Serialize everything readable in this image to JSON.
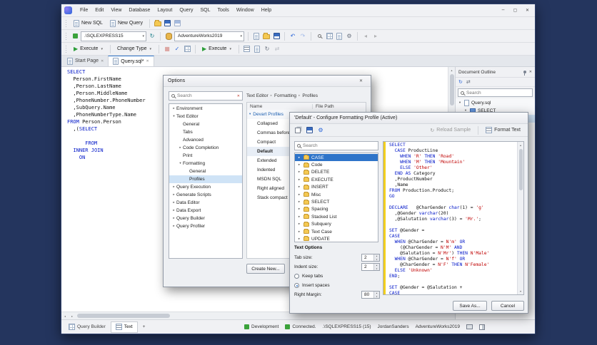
{
  "colors": {
    "accent": "#2e74c9",
    "keyword": "#0016c8",
    "string": "#bf0000",
    "selection": "#2e74c9",
    "change_bar": "#f2cf1e",
    "status_green": "#3ba23b",
    "desktop": "#24355e"
  },
  "icons": {
    "play": "▶",
    "dropdown": "▾",
    "close": "✕",
    "minimize": "─",
    "maximize": "▢",
    "undo": "↶",
    "redo": "↷",
    "refresh": "↻",
    "gear": "⚙",
    "collapsed": "▸",
    "expanded": "▾",
    "chevron": "▸",
    "up": "▴",
    "down": "▾",
    "left": "◂",
    "right": "▸",
    "stop": "■",
    "check": "✓",
    "swap": "⇄"
  },
  "titlebar": {
    "menu": [
      "File",
      "Edit",
      "View",
      "Database",
      "Layout",
      "Query",
      "SQL",
      "Tools",
      "Window",
      "Help"
    ]
  },
  "toolbar_standard": {
    "new_sql": "New SQL",
    "new_query": "New Query"
  },
  "toolbar_connection": {
    "server": ".\\SQLEXPRESS15",
    "database": "AdventureWorks2019"
  },
  "toolbar_query": {
    "execute": "Execute",
    "change_type": "Change Type",
    "execute_secondary": "Execute"
  },
  "doc_tabs": [
    {
      "label": "Start Page"
    },
    {
      "label": "Query.sql*",
      "active": true
    }
  ],
  "editor_code": [
    [
      [
        "k",
        "SELECT"
      ]
    ],
    [
      [
        "p",
        "  Person.FirstName"
      ]
    ],
    [
      [
        "p",
        "  ,Person.LastName"
      ]
    ],
    [
      [
        "p",
        "  ,Person.MiddleName"
      ]
    ],
    [
      [
        "p",
        "  ,PhoneNumber.PhoneNumber"
      ]
    ],
    [
      [
        "p",
        "  ,SubQuery.Name"
      ]
    ],
    [
      [
        "p",
        "  ,PhoneNumberType.Name"
      ]
    ],
    [
      [
        "k",
        "FROM"
      ],
      [
        "p",
        " Person.Person"
      ]
    ],
    [
      [
        "p",
        "  ,("
      ],
      [
        "k",
        "SELECT"
      ]
    ],
    [],
    [
      [
        "p",
        "      "
      ],
      [
        "k",
        "FROM"
      ]
    ],
    [
      [
        "p",
        "  "
      ],
      [
        "k",
        "INNER JOIN"
      ]
    ],
    [
      [
        "p",
        "    "
      ],
      [
        "k",
        "ON"
      ]
    ]
  ],
  "document_outline": {
    "title": "Document Outline",
    "search_placeholder": "Search",
    "tree": [
      {
        "label": "Query.sql",
        "indent": 0,
        "arrow": "expanded",
        "icon": "doc"
      },
      {
        "label": "SELECT",
        "indent": 1,
        "arrow": "expanded",
        "icon": "table"
      },
      {
        "label": "SELECT",
        "indent": 2,
        "icon": "table",
        "selected": true
      }
    ]
  },
  "status_bar": {
    "tabs": [
      {
        "label": "Query Builder",
        "icon": "grid"
      },
      {
        "label": "Text",
        "icon": "text",
        "active": true
      },
      {
        "label": "+",
        "icon": "none"
      }
    ],
    "environment": "Development",
    "connection_state": "Connected.",
    "server": ".\\SQLEXPRESS15 (15)",
    "user": "JordanSanders",
    "database": "AdventureWorks2019"
  },
  "options_dialog": {
    "title": "Options",
    "search_placeholder": "Search",
    "tree": [
      {
        "label": "Environment",
        "indent": 0,
        "arrow": "collapsed"
      },
      {
        "label": "Text Editor",
        "indent": 0,
        "arrow": "expanded"
      },
      {
        "label": "General",
        "indent": 1
      },
      {
        "label": "Tabs",
        "indent": 1
      },
      {
        "label": "Advanced",
        "indent": 1
      },
      {
        "label": "Code Completion",
        "indent": 1,
        "arrow": "collapsed"
      },
      {
        "label": "Print",
        "indent": 1
      },
      {
        "label": "Formatting",
        "indent": 1,
        "arrow": "expanded"
      },
      {
        "label": "General",
        "indent": 2
      },
      {
        "label": "Profiles",
        "indent": 2,
        "selected": true
      },
      {
        "label": "Query Execution",
        "indent": 0,
        "arrow": "collapsed"
      },
      {
        "label": "Generate Scripts",
        "indent": 0,
        "arrow": "collapsed"
      },
      {
        "label": "Data Editor",
        "indent": 0,
        "arrow": "collapsed"
      },
      {
        "label": "Data Export",
        "indent": 0,
        "arrow": "collapsed"
      },
      {
        "label": "Query Builder",
        "indent": 0,
        "arrow": "collapsed"
      },
      {
        "label": "Query Profiler",
        "indent": 0,
        "arrow": "collapsed"
      }
    ],
    "breadcrumb": [
      "Text Editor",
      "Formatting",
      "Profiles"
    ],
    "columns": [
      "Name",
      "File Path"
    ],
    "profiles_group": "Devart Profiles",
    "profiles": [
      {
        "name": "Collapsed"
      },
      {
        "name": "Commas before"
      },
      {
        "name": "Compact"
      },
      {
        "name": "Default",
        "active": true
      },
      {
        "name": "Extended"
      },
      {
        "name": "Indented"
      },
      {
        "name": "MSDN SQL"
      },
      {
        "name": "Right aligned"
      },
      {
        "name": "Stack compact"
      }
    ],
    "create_button": "Create New..."
  },
  "profile_dialog": {
    "title": "'Default' - Configure Formatting Profile (Active)",
    "reload_sample": "Reload Sample",
    "format_text": "Format Text",
    "search_placeholder": "Search",
    "folders": [
      {
        "label": "CASE",
        "selected": true
      },
      {
        "label": "Code"
      },
      {
        "label": "DELETE"
      },
      {
        "label": "EXECUTE"
      },
      {
        "label": "INSERT"
      },
      {
        "label": "Misc"
      },
      {
        "label": "SELECT"
      },
      {
        "label": "Spacing"
      },
      {
        "label": "Stacked List"
      },
      {
        "label": "Subquery"
      },
      {
        "label": "Text Case"
      },
      {
        "label": "UPDATE"
      }
    ],
    "text_options": {
      "heading": "Text Options",
      "tab_size_label": "Tab size:",
      "tab_size": "2",
      "indent_size_label": "Indent size:",
      "indent_size": "2",
      "keep_tabs": "Keep tabs",
      "insert_spaces": "Insert spaces",
      "right_margin_label": "Right Margin:",
      "right_margin": "80"
    },
    "preview_code": [
      [
        [
          "k",
          "SELECT"
        ]
      ],
      [
        [
          "p",
          "  "
        ],
        [
          "k",
          "CASE"
        ],
        [
          "p",
          " ProductLine"
        ]
      ],
      [
        [
          "p",
          "    "
        ],
        [
          "k",
          "WHEN"
        ],
        [
          "p",
          " "
        ],
        [
          "s",
          "'R'"
        ],
        [
          "p",
          " "
        ],
        [
          "k",
          "THEN"
        ],
        [
          "p",
          " "
        ],
        [
          "s",
          "'Road'"
        ]
      ],
      [
        [
          "p",
          "    "
        ],
        [
          "k",
          "WHEN"
        ],
        [
          "p",
          " "
        ],
        [
          "s",
          "'M'"
        ],
        [
          "p",
          " "
        ],
        [
          "k",
          "THEN"
        ],
        [
          "p",
          " "
        ],
        [
          "s",
          "'Mountain'"
        ]
      ],
      [
        [
          "p",
          "    "
        ],
        [
          "k",
          "ELSE"
        ],
        [
          "p",
          " "
        ],
        [
          "s",
          "'Other'"
        ]
      ],
      [
        [
          "p",
          "  "
        ],
        [
          "k",
          "END"
        ],
        [
          "p",
          " "
        ],
        [
          "k",
          "AS"
        ],
        [
          "p",
          " Category"
        ]
      ],
      [
        [
          "p",
          "  ,ProductNumber"
        ]
      ],
      [
        [
          "p",
          "  ,Name"
        ]
      ],
      [
        [
          "k",
          "FROM"
        ],
        [
          "p",
          " Production.Product;"
        ]
      ],
      [
        [
          "k",
          "GO"
        ]
      ],
      [],
      [
        [
          "k",
          "DECLARE"
        ],
        [
          "p",
          "   @CharGender "
        ],
        [
          "k",
          "char"
        ],
        [
          "p",
          "(1) = "
        ],
        [
          "s",
          "'g'"
        ]
      ],
      [
        [
          "p",
          "  ,@Gender "
        ],
        [
          "k",
          "varchar"
        ],
        [
          "p",
          "(20)"
        ]
      ],
      [
        [
          "p",
          "  ,@Salutation "
        ],
        [
          "k",
          "varchar"
        ],
        [
          "p",
          "(3) = "
        ],
        [
          "s",
          "'Mr.'"
        ],
        [
          "p",
          ";"
        ]
      ],
      [],
      [
        [
          "k",
          "SET"
        ],
        [
          "p",
          " @Gender ="
        ]
      ],
      [
        [
          "k",
          "CASE"
        ]
      ],
      [
        [
          "p",
          "  "
        ],
        [
          "k",
          "WHEN"
        ],
        [
          "p",
          " @CharGender = "
        ],
        [
          "s",
          "N'm'"
        ],
        [
          "p",
          " "
        ],
        [
          "k",
          "OR"
        ]
      ],
      [
        [
          "p",
          "    (@CharGender = "
        ],
        [
          "s",
          "N'M'"
        ],
        [
          "p",
          " "
        ],
        [
          "k",
          "AND"
        ]
      ],
      [
        [
          "p",
          "    @Salutation = "
        ],
        [
          "s",
          "N'Mr'"
        ],
        [
          "p",
          ") "
        ],
        [
          "k",
          "THEN"
        ],
        [
          "p",
          " "
        ],
        [
          "s",
          "N'Male'"
        ]
      ],
      [
        [
          "p",
          "  "
        ],
        [
          "k",
          "WHEN"
        ],
        [
          "p",
          " @CharGender = "
        ],
        [
          "s",
          "N'f'"
        ],
        [
          "p",
          " "
        ],
        [
          "k",
          "OR"
        ]
      ],
      [
        [
          "p",
          "    @CharGender = "
        ],
        [
          "s",
          "N'F'"
        ],
        [
          "p",
          " "
        ],
        [
          "k",
          "THEN"
        ],
        [
          "p",
          " "
        ],
        [
          "s",
          "N'Female'"
        ]
      ],
      [
        [
          "p",
          "  "
        ],
        [
          "k",
          "ELSE"
        ],
        [
          "p",
          " "
        ],
        [
          "s",
          "'Unknown'"
        ]
      ],
      [
        [
          "k",
          "END"
        ],
        [
          "p",
          ";"
        ]
      ],
      [],
      [
        [
          "k",
          "SET"
        ],
        [
          "p",
          " @Gender = @Salutation +"
        ]
      ],
      [
        [
          "k",
          "CASE"
        ]
      ]
    ],
    "save_as": "Save As...",
    "cancel": "Cancel"
  }
}
